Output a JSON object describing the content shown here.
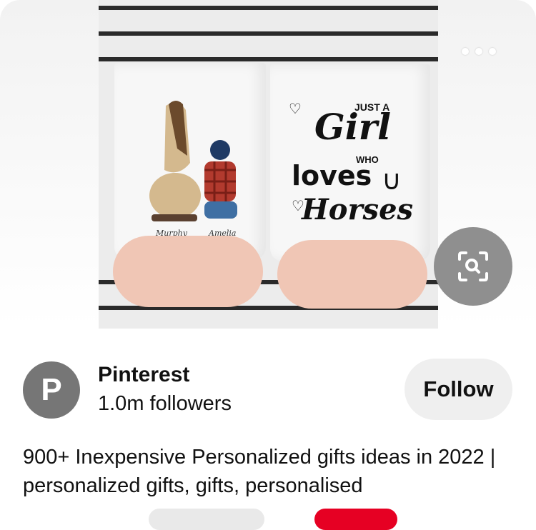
{
  "pin": {
    "image_alt": "Two white mugs held in hands",
    "mug_left": {
      "name1": "Murphy",
      "name2": "Amelia"
    },
    "mug_right": {
      "line1": "JUST A",
      "line2": "Girl",
      "line3": "WHO",
      "line4": "loves",
      "line5": "Horses"
    }
  },
  "creator": {
    "avatar_letter": "P",
    "name": "Pinterest",
    "followers": "1.0m followers",
    "follow_label": "Follow"
  },
  "board": {
    "title": "900+ Inexpensive Personalized gifts ideas in 2022 | personalized gifts, gifts, personalised"
  },
  "icons": {
    "more": "more-options-icon",
    "lens": "visual-search-icon"
  },
  "colors": {
    "accent": "#e60023",
    "button_bg": "#efefef",
    "avatar_bg": "#767676",
    "lens_bg": "#8f8f8f"
  }
}
